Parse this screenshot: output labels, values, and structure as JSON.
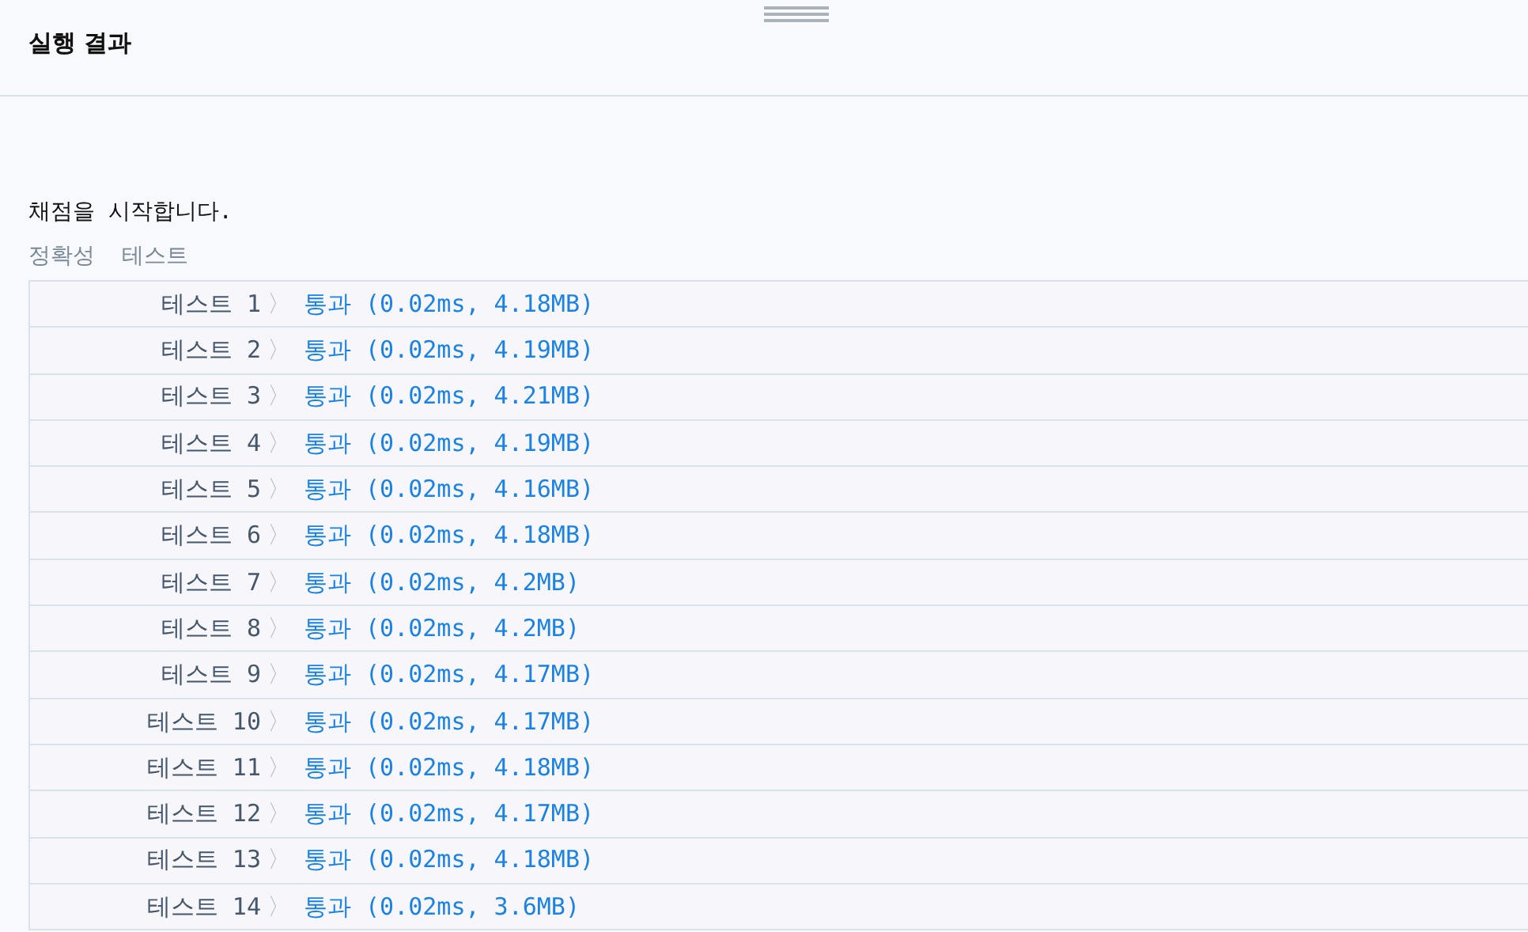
{
  "panel": {
    "title": "실행 결과"
  },
  "output": {
    "message": "채점을 시작합니다.",
    "section_title": "정확성  테스트"
  },
  "tests": [
    {
      "label": "테스트 1",
      "separator": "〉",
      "result": "통과 (0.02ms, 4.18MB)",
      "passed": true
    },
    {
      "label": "테스트 2",
      "separator": "〉",
      "result": "통과 (0.02ms, 4.19MB)",
      "passed": true
    },
    {
      "label": "테스트 3",
      "separator": "〉",
      "result": "통과 (0.02ms, 4.21MB)",
      "passed": true
    },
    {
      "label": "테스트 4",
      "separator": "〉",
      "result": "통과 (0.02ms, 4.19MB)",
      "passed": true
    },
    {
      "label": "테스트 5",
      "separator": "〉",
      "result": "통과 (0.02ms, 4.16MB)",
      "passed": true
    },
    {
      "label": "테스트 6",
      "separator": "〉",
      "result": "통과 (0.02ms, 4.18MB)",
      "passed": true
    },
    {
      "label": "테스트 7",
      "separator": "〉",
      "result": "통과 (0.02ms, 4.2MB)",
      "passed": true
    },
    {
      "label": "테스트 8",
      "separator": "〉",
      "result": "통과 (0.02ms, 4.2MB)",
      "passed": true
    },
    {
      "label": "테스트 9",
      "separator": "〉",
      "result": "통과 (0.02ms, 4.17MB)",
      "passed": true
    },
    {
      "label": "테스트 10",
      "separator": "〉",
      "result": "통과 (0.02ms, 4.17MB)",
      "passed": true
    },
    {
      "label": "테스트 11",
      "separator": "〉",
      "result": "통과 (0.02ms, 4.18MB)",
      "passed": true
    },
    {
      "label": "테스트 12",
      "separator": "〉",
      "result": "통과 (0.02ms, 4.17MB)",
      "passed": true
    },
    {
      "label": "테스트 13",
      "separator": "〉",
      "result": "통과 (0.02ms, 4.18MB)",
      "passed": true
    },
    {
      "label": "테스트 14",
      "separator": "〉",
      "result": "통과 (0.02ms, 3.6MB)",
      "passed": true
    }
  ]
}
